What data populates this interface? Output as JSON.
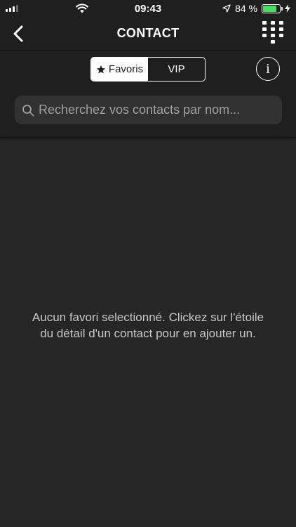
{
  "status_bar": {
    "time": "09:43",
    "battery_percent": "84 %",
    "battery_level": 0.84,
    "battery_color": "#4cd964"
  },
  "nav": {
    "title": "CONTACT",
    "back_icon": "chevron-left-icon",
    "keypad_icon": "dialpad-icon"
  },
  "segments": [
    {
      "label": "Favoris",
      "icon": "star-icon",
      "selected": true
    },
    {
      "label": "VIP",
      "selected": false
    }
  ],
  "info_button": {
    "glyph": "i"
  },
  "search": {
    "placeholder": "Recherchez vos contacts par nom..."
  },
  "empty_state": {
    "message": "Aucun favori selectionné. Clickez sur l'étoile du détail d'un contact pour en ajouter un."
  },
  "colors": {
    "background": "#262626",
    "bar": "#1f1f1f",
    "search_field": "#313131",
    "text": "#ffffff",
    "muted_text": "#c8c8c8"
  }
}
